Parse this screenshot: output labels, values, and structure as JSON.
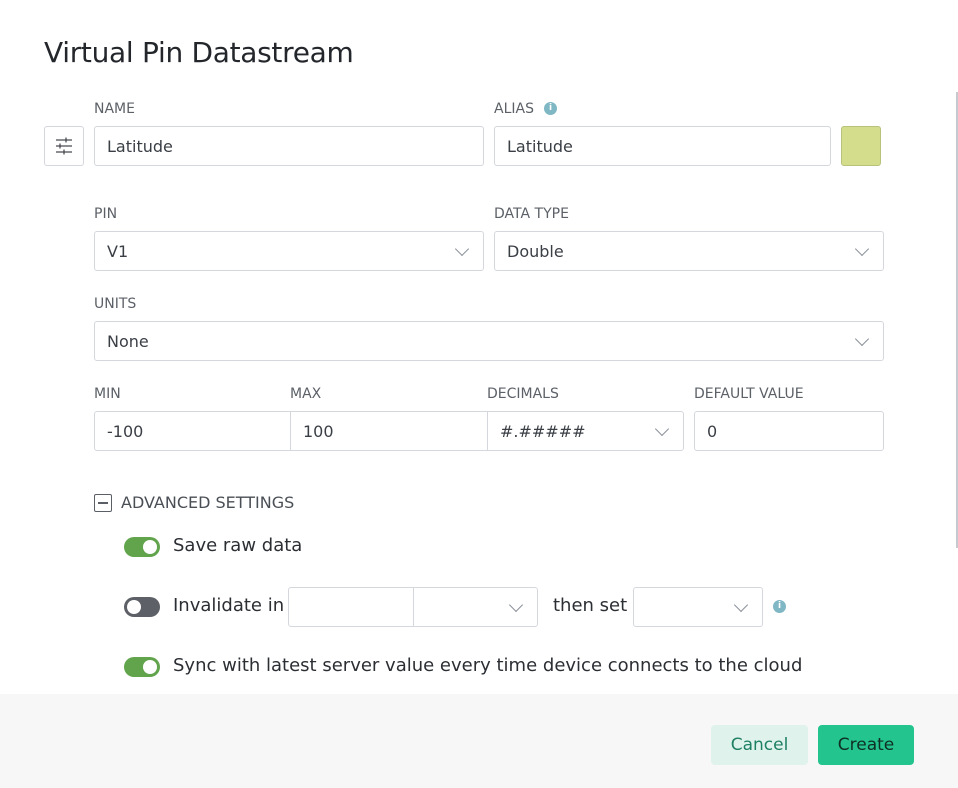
{
  "dialog": {
    "title": "Virtual Pin Datastream"
  },
  "name": {
    "label": "NAME",
    "value": "Latitude"
  },
  "alias": {
    "label": "ALIAS",
    "value": "Latitude",
    "info_icon": "info-icon"
  },
  "color_swatch": {
    "color": "#d4dd8c"
  },
  "pin": {
    "label": "PIN",
    "value": "V1"
  },
  "data_type": {
    "label": "DATA TYPE",
    "value": "Double"
  },
  "units": {
    "label": "UNITS",
    "value": "None"
  },
  "min": {
    "label": "MIN",
    "value": "-100"
  },
  "max": {
    "label": "MAX",
    "value": "100"
  },
  "decimals": {
    "label": "DECIMALS",
    "value": "#.#####"
  },
  "default_value": {
    "label": "DEFAULT VALUE",
    "value": "0"
  },
  "advanced": {
    "label": "ADVANCED SETTINGS",
    "save_raw": {
      "label": "Save raw data",
      "on": true
    },
    "invalidate": {
      "label": "Invalidate in",
      "then_set": "then set",
      "on": false,
      "amount": "",
      "unit": "",
      "set_value": ""
    },
    "sync": {
      "label": "Sync with latest server value every time device connects to the cloud",
      "on": true
    }
  },
  "footer": {
    "cancel": "Cancel",
    "create": "Create"
  },
  "colors": {
    "accent": "#23c48e",
    "toggle_on": "#62a44c",
    "toggle_off": "#5d6066",
    "info": "#7fb7c4"
  }
}
